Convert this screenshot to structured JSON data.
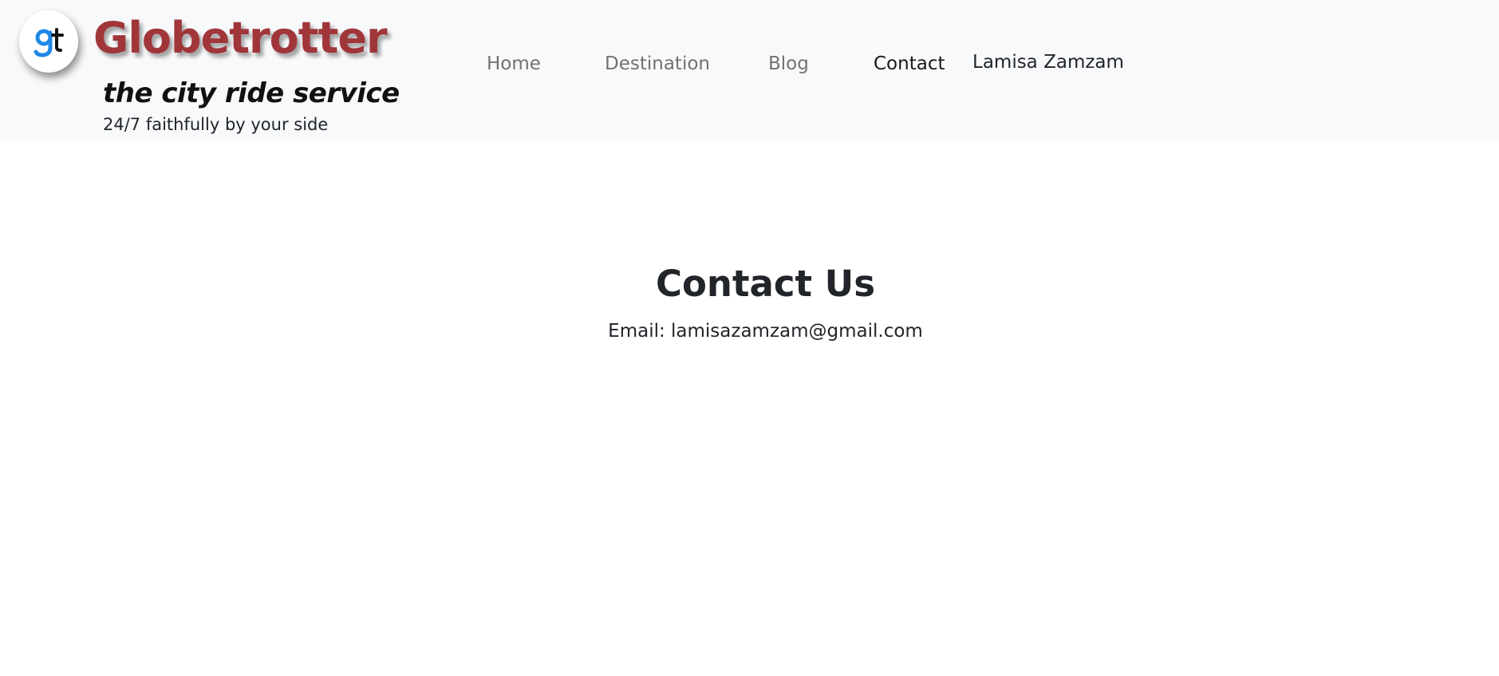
{
  "header": {
    "logo_icon": "globetrotter-gt-logo-icon",
    "brand": "Globetrotter",
    "brand_color": "#a0363a",
    "tagline": "the city ride service",
    "subtagline": "24/7 faithfully by your side"
  },
  "nav": {
    "items": [
      {
        "label": "Home",
        "active": false
      },
      {
        "label": "Destination",
        "active": false
      },
      {
        "label": "Blog",
        "active": false
      },
      {
        "label": "Contact",
        "active": true
      }
    ],
    "user_name": "Lamisa Zamzam"
  },
  "main": {
    "title": "Contact Us",
    "email_line": "Email: lamisazamzam@gmail.com"
  },
  "colors": {
    "navbar_bg": "#f8f9fa",
    "logo_blue": "#1e88e5",
    "text": "#212529"
  }
}
